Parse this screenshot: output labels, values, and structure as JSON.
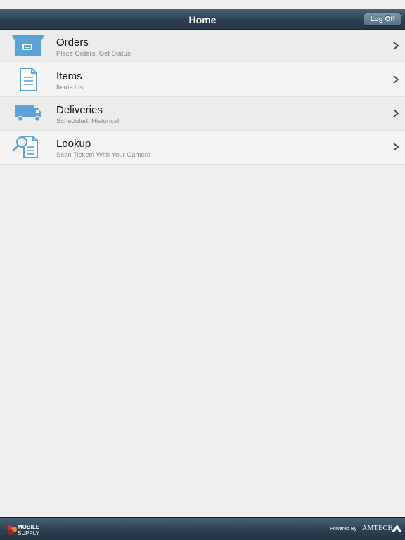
{
  "navbar": {
    "title": "Home",
    "logoff_label": "Log Off"
  },
  "menu": [
    {
      "icon": "box-icon",
      "title": "Orders",
      "subtitle": "Place Orders, Get Status"
    },
    {
      "icon": "document-icon",
      "title": "Items",
      "subtitle": "Items List"
    },
    {
      "icon": "truck-icon",
      "title": "Deliveries",
      "subtitle": "Scheduled, Historical"
    },
    {
      "icon": "magnifier-document-icon",
      "title": "Lookup",
      "subtitle": "Scan Ticket# With Your Camera"
    }
  ],
  "footer": {
    "brand_line1": "MOBILE",
    "brand_line2": "SUPPLY",
    "powered_by": "Powered By",
    "amtech": "AMTECH"
  },
  "colors": {
    "icon_blue": "#5ba3d4",
    "navbar": "#2d4052"
  }
}
